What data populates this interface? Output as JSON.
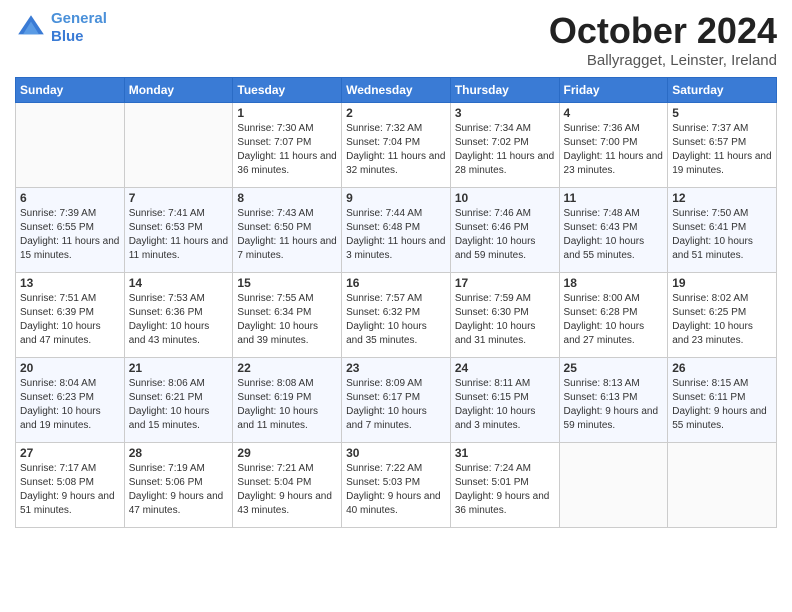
{
  "header": {
    "logo_line1": "General",
    "logo_line2": "Blue",
    "month": "October 2024",
    "location": "Ballyragget, Leinster, Ireland"
  },
  "days_of_week": [
    "Sunday",
    "Monday",
    "Tuesday",
    "Wednesday",
    "Thursday",
    "Friday",
    "Saturday"
  ],
  "weeks": [
    [
      {
        "day": "",
        "sunrise": "",
        "sunset": "",
        "daylight": ""
      },
      {
        "day": "",
        "sunrise": "",
        "sunset": "",
        "daylight": ""
      },
      {
        "day": "1",
        "sunrise": "Sunrise: 7:30 AM",
        "sunset": "Sunset: 7:07 PM",
        "daylight": "Daylight: 11 hours and 36 minutes."
      },
      {
        "day": "2",
        "sunrise": "Sunrise: 7:32 AM",
        "sunset": "Sunset: 7:04 PM",
        "daylight": "Daylight: 11 hours and 32 minutes."
      },
      {
        "day": "3",
        "sunrise": "Sunrise: 7:34 AM",
        "sunset": "Sunset: 7:02 PM",
        "daylight": "Daylight: 11 hours and 28 minutes."
      },
      {
        "day": "4",
        "sunrise": "Sunrise: 7:36 AM",
        "sunset": "Sunset: 7:00 PM",
        "daylight": "Daylight: 11 hours and 23 minutes."
      },
      {
        "day": "5",
        "sunrise": "Sunrise: 7:37 AM",
        "sunset": "Sunset: 6:57 PM",
        "daylight": "Daylight: 11 hours and 19 minutes."
      }
    ],
    [
      {
        "day": "6",
        "sunrise": "Sunrise: 7:39 AM",
        "sunset": "Sunset: 6:55 PM",
        "daylight": "Daylight: 11 hours and 15 minutes."
      },
      {
        "day": "7",
        "sunrise": "Sunrise: 7:41 AM",
        "sunset": "Sunset: 6:53 PM",
        "daylight": "Daylight: 11 hours and 11 minutes."
      },
      {
        "day": "8",
        "sunrise": "Sunrise: 7:43 AM",
        "sunset": "Sunset: 6:50 PM",
        "daylight": "Daylight: 11 hours and 7 minutes."
      },
      {
        "day": "9",
        "sunrise": "Sunrise: 7:44 AM",
        "sunset": "Sunset: 6:48 PM",
        "daylight": "Daylight: 11 hours and 3 minutes."
      },
      {
        "day": "10",
        "sunrise": "Sunrise: 7:46 AM",
        "sunset": "Sunset: 6:46 PM",
        "daylight": "Daylight: 10 hours and 59 minutes."
      },
      {
        "day": "11",
        "sunrise": "Sunrise: 7:48 AM",
        "sunset": "Sunset: 6:43 PM",
        "daylight": "Daylight: 10 hours and 55 minutes."
      },
      {
        "day": "12",
        "sunrise": "Sunrise: 7:50 AM",
        "sunset": "Sunset: 6:41 PM",
        "daylight": "Daylight: 10 hours and 51 minutes."
      }
    ],
    [
      {
        "day": "13",
        "sunrise": "Sunrise: 7:51 AM",
        "sunset": "Sunset: 6:39 PM",
        "daylight": "Daylight: 10 hours and 47 minutes."
      },
      {
        "day": "14",
        "sunrise": "Sunrise: 7:53 AM",
        "sunset": "Sunset: 6:36 PM",
        "daylight": "Daylight: 10 hours and 43 minutes."
      },
      {
        "day": "15",
        "sunrise": "Sunrise: 7:55 AM",
        "sunset": "Sunset: 6:34 PM",
        "daylight": "Daylight: 10 hours and 39 minutes."
      },
      {
        "day": "16",
        "sunrise": "Sunrise: 7:57 AM",
        "sunset": "Sunset: 6:32 PM",
        "daylight": "Daylight: 10 hours and 35 minutes."
      },
      {
        "day": "17",
        "sunrise": "Sunrise: 7:59 AM",
        "sunset": "Sunset: 6:30 PM",
        "daylight": "Daylight: 10 hours and 31 minutes."
      },
      {
        "day": "18",
        "sunrise": "Sunrise: 8:00 AM",
        "sunset": "Sunset: 6:28 PM",
        "daylight": "Daylight: 10 hours and 27 minutes."
      },
      {
        "day": "19",
        "sunrise": "Sunrise: 8:02 AM",
        "sunset": "Sunset: 6:25 PM",
        "daylight": "Daylight: 10 hours and 23 minutes."
      }
    ],
    [
      {
        "day": "20",
        "sunrise": "Sunrise: 8:04 AM",
        "sunset": "Sunset: 6:23 PM",
        "daylight": "Daylight: 10 hours and 19 minutes."
      },
      {
        "day": "21",
        "sunrise": "Sunrise: 8:06 AM",
        "sunset": "Sunset: 6:21 PM",
        "daylight": "Daylight: 10 hours and 15 minutes."
      },
      {
        "day": "22",
        "sunrise": "Sunrise: 8:08 AM",
        "sunset": "Sunset: 6:19 PM",
        "daylight": "Daylight: 10 hours and 11 minutes."
      },
      {
        "day": "23",
        "sunrise": "Sunrise: 8:09 AM",
        "sunset": "Sunset: 6:17 PM",
        "daylight": "Daylight: 10 hours and 7 minutes."
      },
      {
        "day": "24",
        "sunrise": "Sunrise: 8:11 AM",
        "sunset": "Sunset: 6:15 PM",
        "daylight": "Daylight: 10 hours and 3 minutes."
      },
      {
        "day": "25",
        "sunrise": "Sunrise: 8:13 AM",
        "sunset": "Sunset: 6:13 PM",
        "daylight": "Daylight: 9 hours and 59 minutes."
      },
      {
        "day": "26",
        "sunrise": "Sunrise: 8:15 AM",
        "sunset": "Sunset: 6:11 PM",
        "daylight": "Daylight: 9 hours and 55 minutes."
      }
    ],
    [
      {
        "day": "27",
        "sunrise": "Sunrise: 7:17 AM",
        "sunset": "Sunset: 5:08 PM",
        "daylight": "Daylight: 9 hours and 51 minutes."
      },
      {
        "day": "28",
        "sunrise": "Sunrise: 7:19 AM",
        "sunset": "Sunset: 5:06 PM",
        "daylight": "Daylight: 9 hours and 47 minutes."
      },
      {
        "day": "29",
        "sunrise": "Sunrise: 7:21 AM",
        "sunset": "Sunset: 5:04 PM",
        "daylight": "Daylight: 9 hours and 43 minutes."
      },
      {
        "day": "30",
        "sunrise": "Sunrise: 7:22 AM",
        "sunset": "Sunset: 5:03 PM",
        "daylight": "Daylight: 9 hours and 40 minutes."
      },
      {
        "day": "31",
        "sunrise": "Sunrise: 7:24 AM",
        "sunset": "Sunset: 5:01 PM",
        "daylight": "Daylight: 9 hours and 36 minutes."
      },
      {
        "day": "",
        "sunrise": "",
        "sunset": "",
        "daylight": ""
      },
      {
        "day": "",
        "sunrise": "",
        "sunset": "",
        "daylight": ""
      }
    ]
  ]
}
